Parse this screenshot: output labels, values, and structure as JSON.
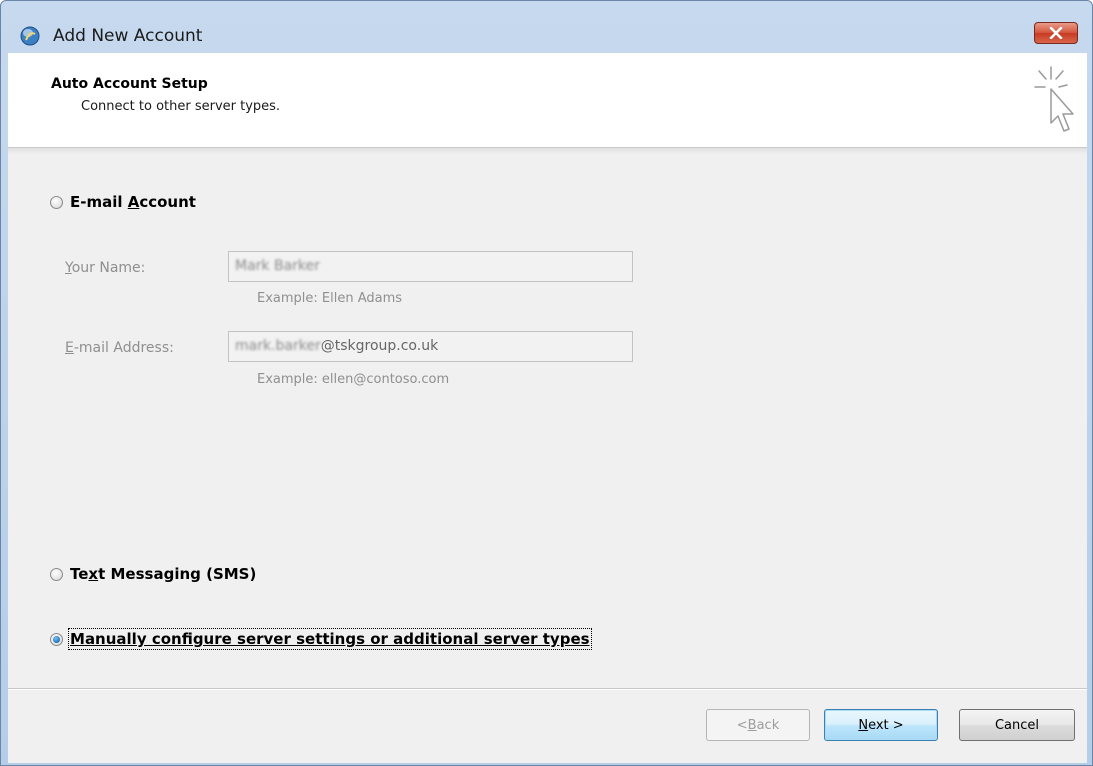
{
  "window": {
    "title": "Add New Account"
  },
  "header": {
    "title": "Auto Account Setup",
    "subtitle": "Connect to other server types."
  },
  "options": {
    "email_account": {
      "pre": "E-mail ",
      "key": "A",
      "post": "ccount",
      "checked": false
    },
    "text_messaging": {
      "pre": "Te",
      "key": "x",
      "post": "t Messaging (SMS)",
      "checked": false
    },
    "manual": {
      "pre": "",
      "key": "M",
      "post": "anually configure server settings or additional server types",
      "checked": true
    }
  },
  "fields": {
    "your_name": {
      "label_key": "Y",
      "label_rest": "our Name:",
      "value": "Mark Barker",
      "example": "Example: Ellen Adams"
    },
    "email_address": {
      "label_key": "E",
      "label_rest": "-mail Address:",
      "value_blurred": "mark.barker",
      "value_domain": "@tskgroup.co.uk",
      "example": "Example: ellen@contoso.com"
    }
  },
  "buttons": {
    "back": {
      "pre": "< ",
      "key": "B",
      "post": "ack",
      "disabled": true
    },
    "next": {
      "pre": "",
      "key": "N",
      "post": "ext >",
      "default": true
    },
    "cancel": {
      "label": "Cancel"
    }
  },
  "colors": {
    "client_bg": "#f0f0f0",
    "title_bg": "#c6d9ee",
    "close_red": "#c73b22",
    "radio_selected": "#1b6fb8",
    "disabled_text": "#8f8f8f"
  }
}
